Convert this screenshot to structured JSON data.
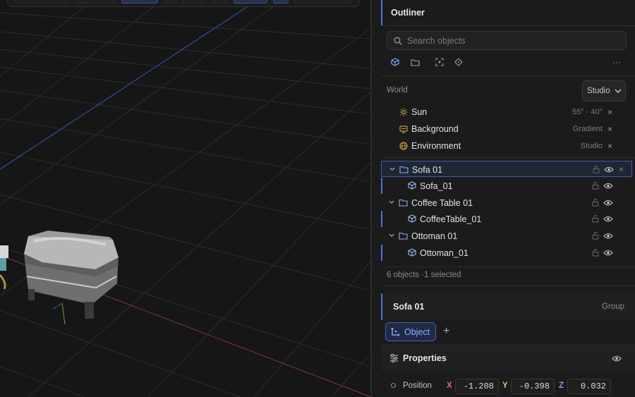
{
  "outliner": {
    "title": "Outliner",
    "search_placeholder": "Search objects",
    "filters": [
      "cube-filter-icon",
      "folder-filter-icon",
      "focus-icon",
      "crosshair-icon",
      "more-icon"
    ],
    "more_label": "···",
    "world_label": "World",
    "world_preset": "Studio",
    "world_items": [
      {
        "name": "Sun",
        "value": "55° · 40°",
        "icon": "sun-icon"
      },
      {
        "name": "Background",
        "value": "Gradient",
        "icon": "background-icon"
      },
      {
        "name": "Environment",
        "value": "Studio",
        "icon": "globe-icon"
      }
    ],
    "tree": [
      {
        "name": "Sofa 01",
        "type": "group",
        "selected": true
      },
      {
        "name": "Sofa_01",
        "type": "mesh",
        "selected": false
      },
      {
        "name": "Coffee Table 01",
        "type": "group",
        "selected": false
      },
      {
        "name": "CoffeeTable_01",
        "type": "mesh",
        "selected": false
      },
      {
        "name": "Ottoman 01",
        "type": "group",
        "selected": false
      },
      {
        "name": "Ottoman_01",
        "type": "mesh",
        "selected": false
      }
    ],
    "close_glyph": "×",
    "status": "6 objects ·1 selected"
  },
  "inspector": {
    "title": "Sofa 01",
    "kind": "Group",
    "tab_label": "Object",
    "add_label": "+",
    "properties_title": "Properties",
    "position_label": "Position",
    "position": {
      "x": "-1.208",
      "y": "-0.398",
      "z": "0.032"
    },
    "axis_labels": {
      "x": "X",
      "y": "Y",
      "z": "Z"
    }
  },
  "colors": {
    "accent": "#4c6fd8",
    "axis_x": "#e06c6c",
    "axis_y": "#d8c36a",
    "axis_z": "#7aa0f0"
  }
}
